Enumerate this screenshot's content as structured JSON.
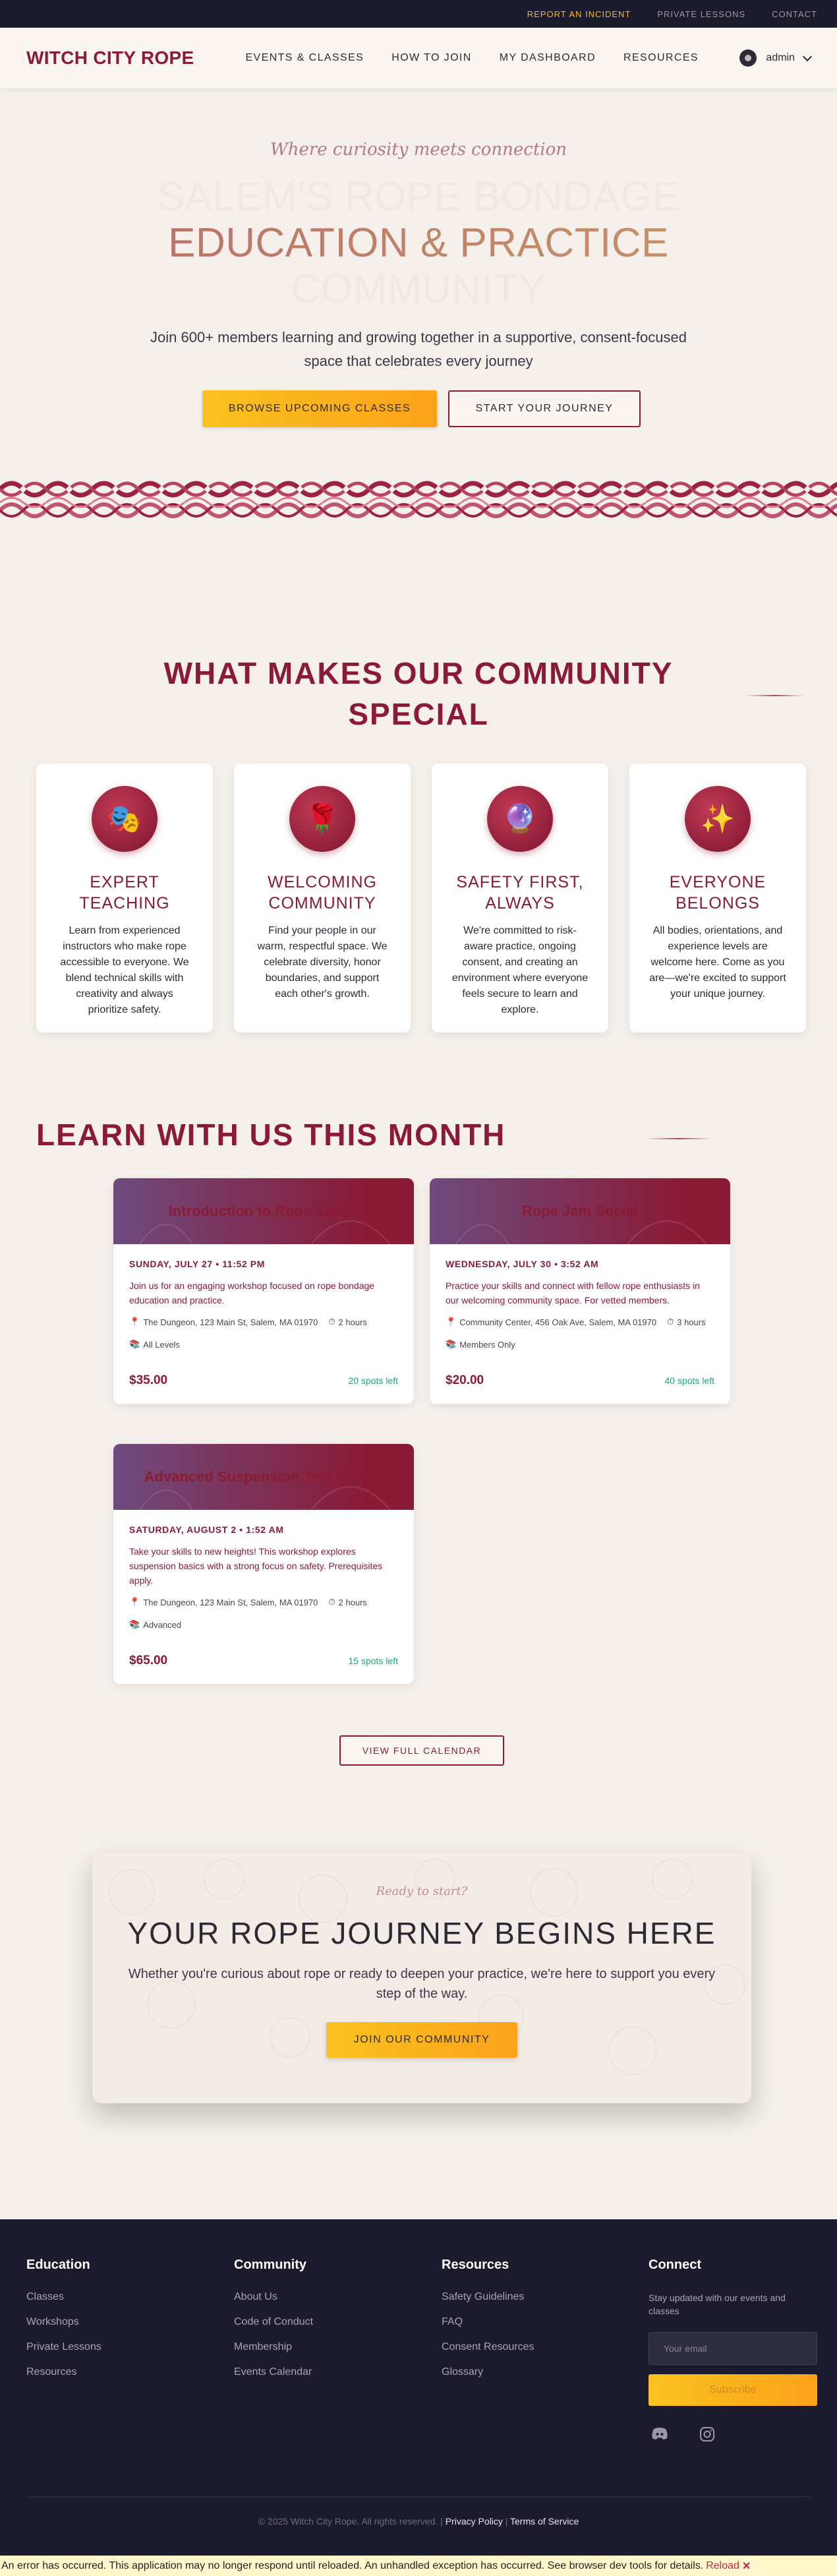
{
  "utility": {
    "report": "REPORT AN INCIDENT",
    "lessons": "PRIVATE LESSONS",
    "contact": "CONTACT"
  },
  "header": {
    "logo": "WITCH CITY ROPE",
    "nav": [
      "EVENTS & CLASSES",
      "HOW TO JOIN",
      "MY DASHBOARD",
      "RESOURCES"
    ],
    "user": "admin"
  },
  "hero": {
    "tagline": "Where curiosity meets connection",
    "title_line1": "SALEM'S ROPE BONDAGE",
    "title_line2": "EDUCATION & PRACTICE",
    "title_line3": "COMMUNITY",
    "subtitle": "Join 600+ members learning and growing together in a supportive, consent-focused space that celebrates every journey",
    "primary_cta": "BROWSE UPCOMING CLASSES",
    "secondary_cta": "START YOUR JOURNEY"
  },
  "features": {
    "title": "WHAT MAKES OUR COMMUNITY SPECIAL",
    "cards": [
      {
        "icon": "🎭",
        "title": "EXPERT TEACHING",
        "text": "Learn from experienced instructors who make rope accessible to everyone. We blend technical skills with creativity and always prioritize safety."
      },
      {
        "icon": "🌹",
        "title": "WELCOMING COMMUNITY",
        "text": "Find your people in our warm, respectful space. We celebrate diversity, honor boundaries, and support each other's growth."
      },
      {
        "icon": "🔮",
        "title": "SAFETY FIRST, ALWAYS",
        "text": "We're committed to risk-aware practice, ongoing consent, and creating an environment where everyone feels secure to learn and explore."
      },
      {
        "icon": "✨",
        "title": "EVERYONE BELONGS",
        "text": "All bodies, orientations, and experience levels are welcome here. Come as you are—we're excited to support your unique journey."
      }
    ]
  },
  "learn": {
    "title": "LEARN WITH US THIS MONTH",
    "events": [
      {
        "name": "Introduction to Rope Safety",
        "date": "SUNDAY, JULY 27 • 11:52 PM",
        "desc": "Join us for an engaging workshop focused on rope bondage education and practice.",
        "location": "The Dungeon, 123 Main St, Salem, MA 01970",
        "duration": "2 hours",
        "level": "All Levels",
        "price": "$35.00",
        "spots": "20 spots left"
      },
      {
        "name": "Rope Jam Social",
        "date": "WEDNESDAY, JULY 30 • 3:52 AM",
        "desc": "Practice your skills and connect with fellow rope enthusiasts in our welcoming community space. For vetted members.",
        "location": "Community Center, 456 Oak Ave, Salem, MA 01970",
        "duration": "3 hours",
        "level": "Members Only",
        "price": "$20.00",
        "spots": "40 spots left"
      },
      {
        "name": "Advanced Suspension Techniques",
        "date": "SATURDAY, AUGUST 2 • 1:52 AM",
        "desc": "Take your skills to new heights! This workshop explores suspension basics with a strong focus on safety. Prerequisites apply.",
        "location": "The Dungeon, 123 Main St, Salem, MA 01970",
        "duration": "2 hours",
        "level": "Advanced",
        "price": "$65.00",
        "spots": "15 spots left"
      }
    ],
    "calendar_cta": "VIEW FULL CALENDAR"
  },
  "cta": {
    "ready": "Ready to start?",
    "title": "YOUR ROPE JOURNEY BEGINS HERE",
    "text": "Whether you're curious about rope or ready to deepen your practice, we're here to support you every step of the way.",
    "button": "JOIN OUR COMMUNITY"
  },
  "footer": {
    "education": {
      "title": "Education",
      "links": [
        "Classes",
        "Workshops",
        "Private Lessons",
        "Resources"
      ]
    },
    "community": {
      "title": "Community",
      "links": [
        "About Us",
        "Code of Conduct",
        "Membership",
        "Events Calendar"
      ]
    },
    "resources": {
      "title": "Resources",
      "links": [
        "Safety Guidelines",
        "FAQ",
        "Consent Resources",
        "Glossary"
      ]
    },
    "connect": {
      "title": "Connect",
      "blurb": "Stay updated with our events and classes",
      "email_placeholder": "Your email",
      "subscribe": "Subscribe"
    },
    "copyright": "© 2025 Witch City Rope. All rights reserved.",
    "privacy": "Privacy Policy",
    "terms": "Terms of Service",
    "sep": "|"
  },
  "error": {
    "message": "An error has occurred. This application may no longer respond until reloaded. An unhandled exception has occurred. See browser dev tools for details.",
    "reload": "Reload",
    "close": "✕"
  },
  "colors": {
    "burgundy": "#8b1a35",
    "amber": "#fca21b",
    "navy": "#1c1b2e",
    "cream": "#f5f0eb",
    "green": "#1fa873"
  },
  "icons": [
    "map-pin-icon",
    "clock-icon",
    "books-icon",
    "discord-icon",
    "instagram-icon",
    "chevron-down-icon",
    "user-avatar-icon"
  ]
}
